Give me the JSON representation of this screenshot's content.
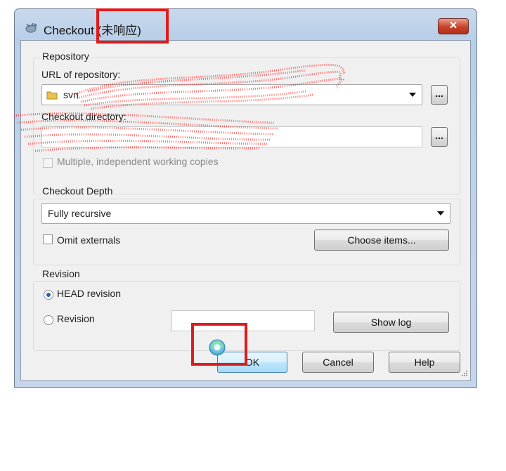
{
  "window": {
    "title": "Checkout (未响应)",
    "close_label": "✕"
  },
  "repository": {
    "group_title": "Repository",
    "url_label": "URL of repository:",
    "url_value": "svn",
    "browse_label": "...",
    "checkout_dir_label": "Checkout directory:",
    "checkout_dir_value": "",
    "multiple_label": "Multiple, independent working copies",
    "multiple_checked": false,
    "multiple_enabled": false
  },
  "depth": {
    "group_title": "Checkout Depth",
    "selected": "Fully recursive",
    "omit_externals_label": "Omit externals",
    "omit_externals_checked": false,
    "choose_items_label": "Choose items..."
  },
  "revision": {
    "group_title": "Revision",
    "head_label": "HEAD revision",
    "head_selected": true,
    "revision_label": "Revision",
    "revision_value": "",
    "show_log_label": "Show log"
  },
  "buttons": {
    "ok": "OK",
    "cancel": "Cancel",
    "help": "Help"
  },
  "colors": {
    "annotation_red": "#e01b1b",
    "scribble_red": "#ff0000"
  }
}
